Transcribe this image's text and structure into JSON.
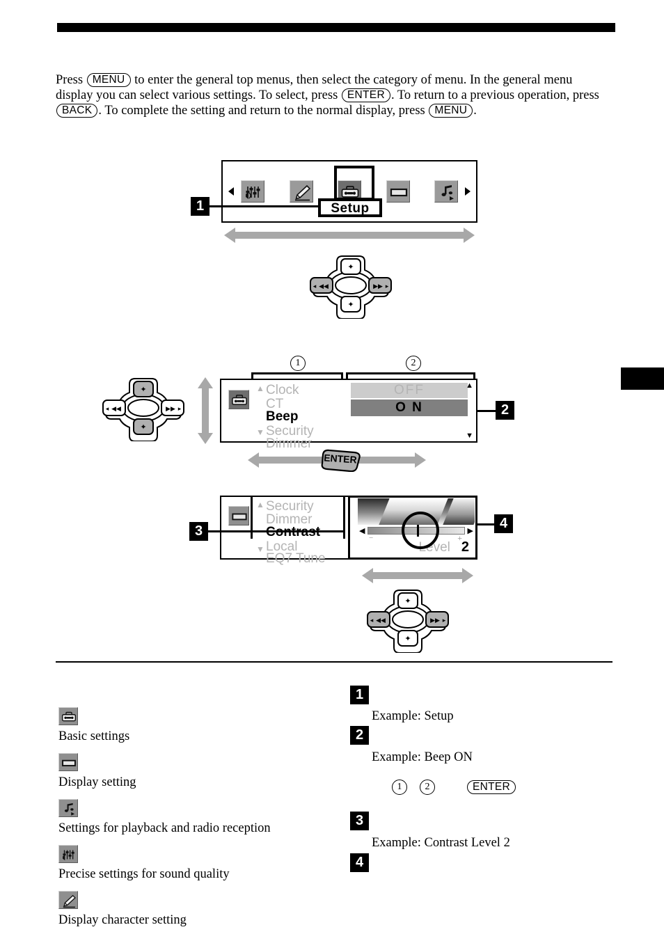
{
  "document": {
    "intro_parts": {
      "p1": "Press ",
      "key_menu_1": "MENU",
      "p2": " to enter the general top menus, then select the category of menu. In the general menu display you can select various settings. To select, press ",
      "key_enter": "ENTER",
      "p3": ". To return to a previous operation, press ",
      "key_back": "BACK",
      "p4": ". To complete the setting and return to the normal display, press ",
      "key_menu_2": "MENU",
      "p5": "."
    }
  },
  "step_badges": {
    "one": "1",
    "two": "2",
    "three": "3",
    "four": "4"
  },
  "circled": {
    "one": "1",
    "two": "2"
  },
  "top_menu_screen": {
    "scroll_left": "◀",
    "scroll_right": "▶",
    "selected_label": "Setup",
    "icons": [
      {
        "name": "sound-quality-icon",
        "selected": false
      },
      {
        "name": "display-character-icon",
        "selected": false
      },
      {
        "name": "basic-settings-icon",
        "selected": true
      },
      {
        "name": "display-setting-icon",
        "selected": false
      },
      {
        "name": "playback-radio-icon",
        "selected": false
      }
    ]
  },
  "setup_screen": {
    "category_icon": "basic-settings-icon",
    "items": [
      "Clock",
      "CT",
      "Beep",
      "Security",
      "Dimmer"
    ],
    "selected_item": "Beep",
    "values": [
      "OFF",
      "O N"
    ],
    "selected_value": "O N"
  },
  "enter_arrow": {
    "label": "ENTER"
  },
  "contrast_screen": {
    "category_icon": "display-setting-icon",
    "items": [
      "Security",
      "Dimmer",
      "Contrast",
      "Local",
      "EQ7 Tune"
    ],
    "selected_item": "Contrast",
    "slider_minus": "−",
    "slider_plus": "+",
    "slider_left_arrow": "◀",
    "slider_right_arrow": "▶",
    "level_label": "Level",
    "level_value": "2"
  },
  "legend_left": [
    {
      "icon": "basic-settings-icon",
      "label": "Basic settings"
    },
    {
      "icon": "display-setting-icon",
      "label": "Display setting"
    },
    {
      "icon": "playback-radio-icon",
      "label": "Settings for playback and radio reception"
    },
    {
      "icon": "sound-quality-icon",
      "label": "Precise settings for sound quality"
    },
    {
      "icon": "display-character-icon",
      "label": "Display character setting"
    }
  ],
  "legend_right": {
    "item1": "Example: Setup",
    "item2": "Example: Beep ON",
    "mid_circle_1": "1",
    "mid_circle_2": "2",
    "mid_key": "ENTER",
    "item3": "Example: Contrast Level 2"
  },
  "colors": {
    "ink": "#000000",
    "arrow_gray": "#a8a8a8",
    "icon_gray": "#9a9a9a",
    "icon_gray_selected": "#6e6e6e",
    "lcd_dim_text": "#b4b4b4",
    "value_row_light": "#cccccc",
    "value_row_dark": "#808080"
  }
}
